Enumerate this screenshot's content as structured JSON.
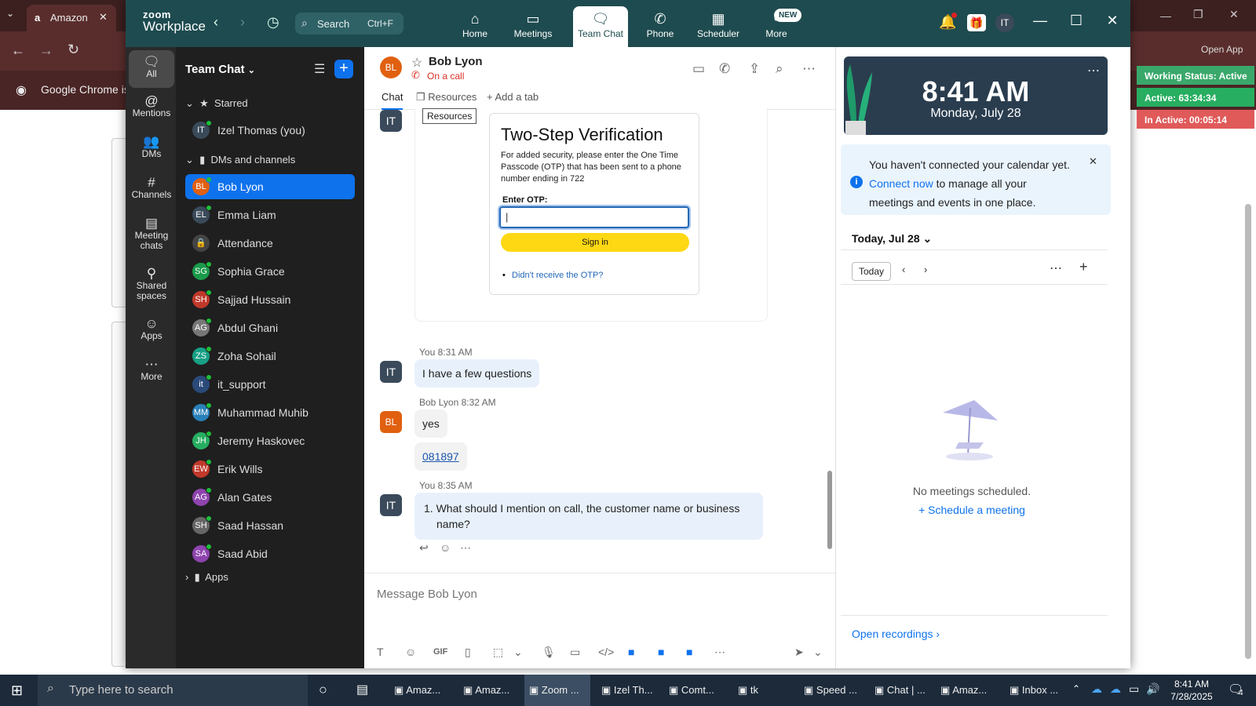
{
  "chrome": {
    "tab_title": "Amazon",
    "infobar_text": "Google Chrome isn",
    "open_app": "Open App"
  },
  "zoom": {
    "logo_top": "zoom",
    "logo_bottom": "Workplace",
    "search_label": "Search",
    "search_shortcut": "Ctrl+F",
    "nav": [
      {
        "label": "Home",
        "icon": "⌂"
      },
      {
        "label": "Meetings",
        "icon": "▭"
      },
      {
        "label": "Team Chat",
        "icon": "🗨"
      },
      {
        "label": "Phone",
        "icon": "✆"
      },
      {
        "label": "Scheduler",
        "icon": "▦"
      },
      {
        "label": "More",
        "icon": "•"
      }
    ],
    "new_badge": "NEW",
    "profile_initials": "IT"
  },
  "rail": [
    {
      "label": "All",
      "icon": "🗨"
    },
    {
      "label": "Mentions",
      "icon": "@"
    },
    {
      "label": "DMs",
      "icon": "👥"
    },
    {
      "label": "Channels",
      "icon": "#"
    },
    {
      "label": "Meeting chats",
      "icon": "▤"
    },
    {
      "label": "Shared spaces",
      "icon": "⚲"
    },
    {
      "label": "Apps",
      "icon": "☺"
    },
    {
      "label": "More",
      "icon": "⋯"
    }
  ],
  "list": {
    "title": "Team Chat",
    "starred_label": "Starred",
    "dms_label": "DMs and channels",
    "apps_label": "Apps",
    "starred": [
      {
        "initials": "IT",
        "name": "Izel Thomas (you)",
        "color": "#3a4a5a"
      }
    ],
    "contacts": [
      {
        "initials": "BL",
        "name": "Bob Lyon",
        "color": "#e06010"
      },
      {
        "initials": "EL",
        "name": "Emma Liam",
        "color": "#3a4a5a"
      },
      {
        "initials": "🔒",
        "name": "Attendance",
        "color": "#444444"
      },
      {
        "initials": "SG",
        "name": "Sophia Grace",
        "color": "#1a9a4a"
      },
      {
        "initials": "SH",
        "name": "Sajjad Hussain",
        "color": "#c0392b"
      },
      {
        "initials": "AG",
        "name": "Abdul Ghani",
        "color": "#777777"
      },
      {
        "initials": "ZS",
        "name": "Zoha Sohail",
        "color": "#16a085"
      },
      {
        "initials": "it",
        "name": "it_support",
        "color": "#2a4a7a"
      },
      {
        "initials": "MM",
        "name": "Muhammad Muhib",
        "color": "#2980b9"
      },
      {
        "initials": "JH",
        "name": "Jeremy Haskovec",
        "color": "#27ae60"
      },
      {
        "initials": "EW",
        "name": "Erik Wills",
        "color": "#c0392b"
      },
      {
        "initials": "AG",
        "name": "Alan Gates",
        "color": "#8e44ad"
      },
      {
        "initials": "SH",
        "name": "Saad Hassan",
        "color": "#666666"
      },
      {
        "initials": "SA",
        "name": "Saad Abid",
        "color": "#8e44ad"
      }
    ]
  },
  "chat": {
    "avatar": "BL",
    "name": "Bob Lyon",
    "status": "On a call",
    "tabs": {
      "chat": "Chat",
      "resources": "Resources",
      "add": "Add a tab"
    },
    "tooltip": "Resources",
    "otp": {
      "title": "Two-Step Verification",
      "desc": "For added security, please enter the One Time Passcode (OTP) that has been sent to a phone number ending in 722",
      "label": "Enter OTP:",
      "signin": "Sign in",
      "link": "Didn't receive the OTP?"
    },
    "messages": [
      {
        "meta": "You 8:31 AM",
        "text": "I have a few questions"
      },
      {
        "meta": "Bob Lyon 8:32 AM",
        "text": "yes",
        "link": "081897"
      },
      {
        "meta": "You 8:35 AM",
        "text": "1. What should I mention on call, the customer name or business name?"
      }
    ],
    "me_initials": "IT",
    "placeholder": "Message Bob Lyon"
  },
  "right": {
    "time": "8:41 AM",
    "date": "Monday, July 28",
    "notice_pre": "You haven't connected your calendar yet.",
    "notice_link": "Connect now",
    "notice_post": "to manage all your meetings and events in one place.",
    "today_head": "Today, Jul 28",
    "today_btn": "Today",
    "no_meetings": "No meetings scheduled.",
    "schedule": "Schedule a meeting",
    "open_recordings": "Open recordings"
  },
  "status_widget": {
    "working": "Working Status: Active",
    "active": "Active: 63:34:34",
    "inactive": "In Active: 00:05:14",
    "colors": {
      "working": "#3aa86a",
      "active": "#27ae60",
      "inactive": "#e05a5a"
    }
  },
  "taskbar": {
    "search": "Type here to search",
    "apps": [
      "Amaz...",
      "Amaz...",
      "Zoom ...",
      "Izel Th...",
      "Comt...",
      "tk",
      "Speed ...",
      "Chat | ...",
      "Amaz...",
      "Inbox ..."
    ],
    "time": "8:41 AM",
    "date": "7/28/2025",
    "notif_count": "4"
  }
}
